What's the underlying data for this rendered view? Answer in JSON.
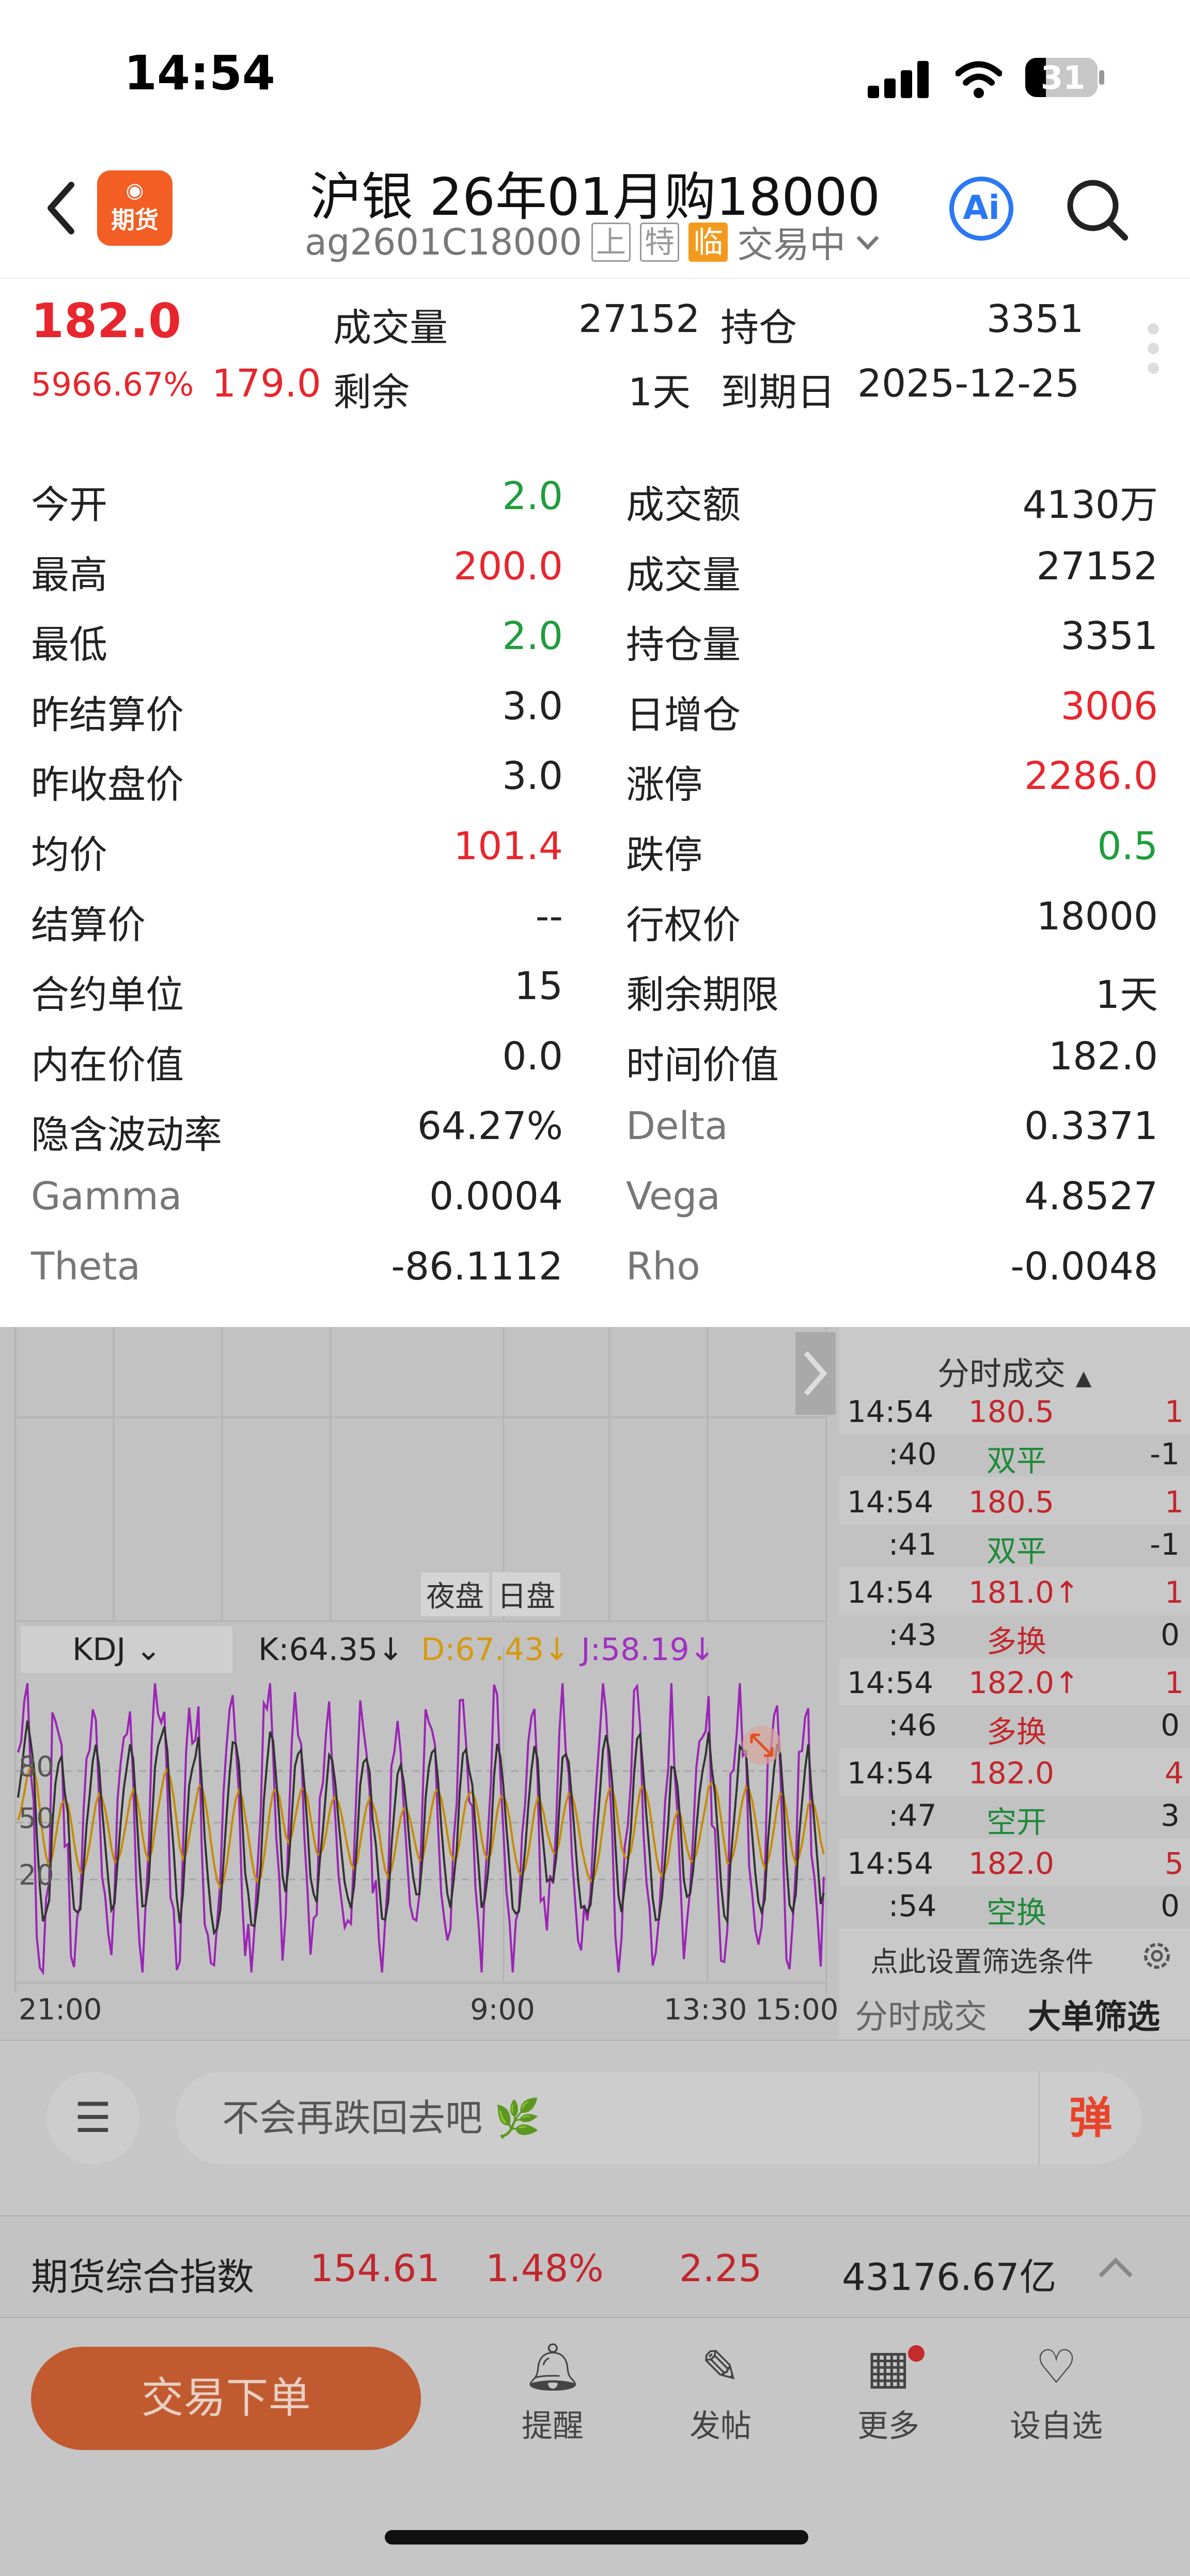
{
  "status": {
    "time": "14:54",
    "battery": "31"
  },
  "header": {
    "title": "沪银 26年01月购18000",
    "code": "ag2601C18000",
    "tags": [
      "上",
      "特",
      "临"
    ],
    "trading_status": "交易中",
    "logo_text": "期货",
    "ai_label": "Ai"
  },
  "quote": {
    "price": "182.0",
    "change_pct": "5966.67%",
    "change": "179.0",
    "volume_label": "成交量",
    "volume": "27152",
    "oi_label": "持仓",
    "oi": "3351",
    "remain_label": "剩余",
    "remain": "1天",
    "expiry_label": "到期日",
    "expiry": "2025-12-25"
  },
  "stats_left": [
    {
      "label": "今开",
      "value": "2.0",
      "color": "#1f9d3c"
    },
    {
      "label": "最高",
      "value": "200.0",
      "color": "#e8262d"
    },
    {
      "label": "最低",
      "value": "2.0",
      "color": "#1f9d3c"
    },
    {
      "label": "昨结算价",
      "value": "3.0",
      "color": "#222222"
    },
    {
      "label": "昨收盘价",
      "value": "3.0",
      "color": "#222222"
    },
    {
      "label": "均价",
      "value": "101.4",
      "color": "#e8262d"
    },
    {
      "label": "结算价",
      "value": "--",
      "color": "#222222"
    },
    {
      "label": "合约单位",
      "value": "15",
      "color": "#222222"
    },
    {
      "label": "内在价值",
      "value": "0.0",
      "color": "#222222"
    },
    {
      "label": "隐含波动率",
      "value": "64.27%",
      "color": "#222222"
    },
    {
      "label": "Gamma",
      "value": "0.0004",
      "color": "#222222"
    },
    {
      "label": "Theta",
      "value": "-86.1112",
      "color": "#222222"
    }
  ],
  "stats_right": [
    {
      "label": "成交额",
      "value": "4130万",
      "color": "#222222"
    },
    {
      "label": "成交量",
      "value": "27152",
      "color": "#222222"
    },
    {
      "label": "持仓量",
      "value": "3351",
      "color": "#222222"
    },
    {
      "label": "日增仓",
      "value": "3006",
      "color": "#e8262d"
    },
    {
      "label": "涨停",
      "value": "2286.0",
      "color": "#e8262d"
    },
    {
      "label": "跌停",
      "value": "0.5",
      "color": "#1f9d3c"
    },
    {
      "label": "行权价",
      "value": "18000",
      "color": "#222222"
    },
    {
      "label": "剩余期限",
      "value": "1天",
      "color": "#222222"
    },
    {
      "label": "时间价值",
      "value": "182.0",
      "color": "#222222"
    },
    {
      "label": "Delta",
      "value": "0.3371",
      "color": "#222222"
    },
    {
      "label": "Vega",
      "value": "4.8527",
      "color": "#222222"
    },
    {
      "label": "Rho",
      "value": "-0.0048",
      "color": "#222222"
    }
  ],
  "chart": {
    "session_night": "夜盘",
    "session_day": "日盘",
    "indicator": "KDJ",
    "k": "K:64.35↓",
    "d": "D:67.43↓",
    "j": "J:58.19↓",
    "yticks": [
      "80",
      "50",
      "20"
    ],
    "xticks": [
      "21:00",
      "9:00",
      "13:30",
      "15:00"
    ]
  },
  "trades": {
    "title": "分时成交",
    "rows": [
      {
        "time": "14:54",
        "sec": ":40",
        "price": "180.5",
        "type": "双平",
        "vol": "1",
        "chg": "-1"
      },
      {
        "time": "14:54",
        "sec": ":41",
        "price": "180.5",
        "type": "双平",
        "vol": "1",
        "chg": "-1"
      },
      {
        "time": "14:54",
        "sec": ":43",
        "price": "181.0↑",
        "type": "多换",
        "vol": "1",
        "chg": "0"
      },
      {
        "time": "14:54",
        "sec": ":46",
        "price": "182.0↑",
        "type": "多换",
        "vol": "1",
        "chg": "0"
      },
      {
        "time": "14:54",
        "sec": ":47",
        "price": "182.0",
        "type": "空开",
        "vol": "4",
        "chg": "3"
      },
      {
        "time": "14:54",
        "sec": ":54",
        "price": "182.0",
        "type": "空换",
        "vol": "5",
        "chg": "0"
      }
    ],
    "filter_hint": "点此设置筛选条件",
    "tab1": "分时成交",
    "tab2": "大单筛选"
  },
  "comment": {
    "placeholder": "不会再跌回去吧",
    "danmaku": "弹"
  },
  "index_bar": {
    "name": "期货综合指数",
    "value": "154.61",
    "pct": "1.48%",
    "chg": "2.25",
    "amount": "43176.67亿"
  },
  "bottom": {
    "trade_btn": "交易下单",
    "nav": [
      "提醒",
      "发帖",
      "更多",
      "设自选"
    ]
  }
}
